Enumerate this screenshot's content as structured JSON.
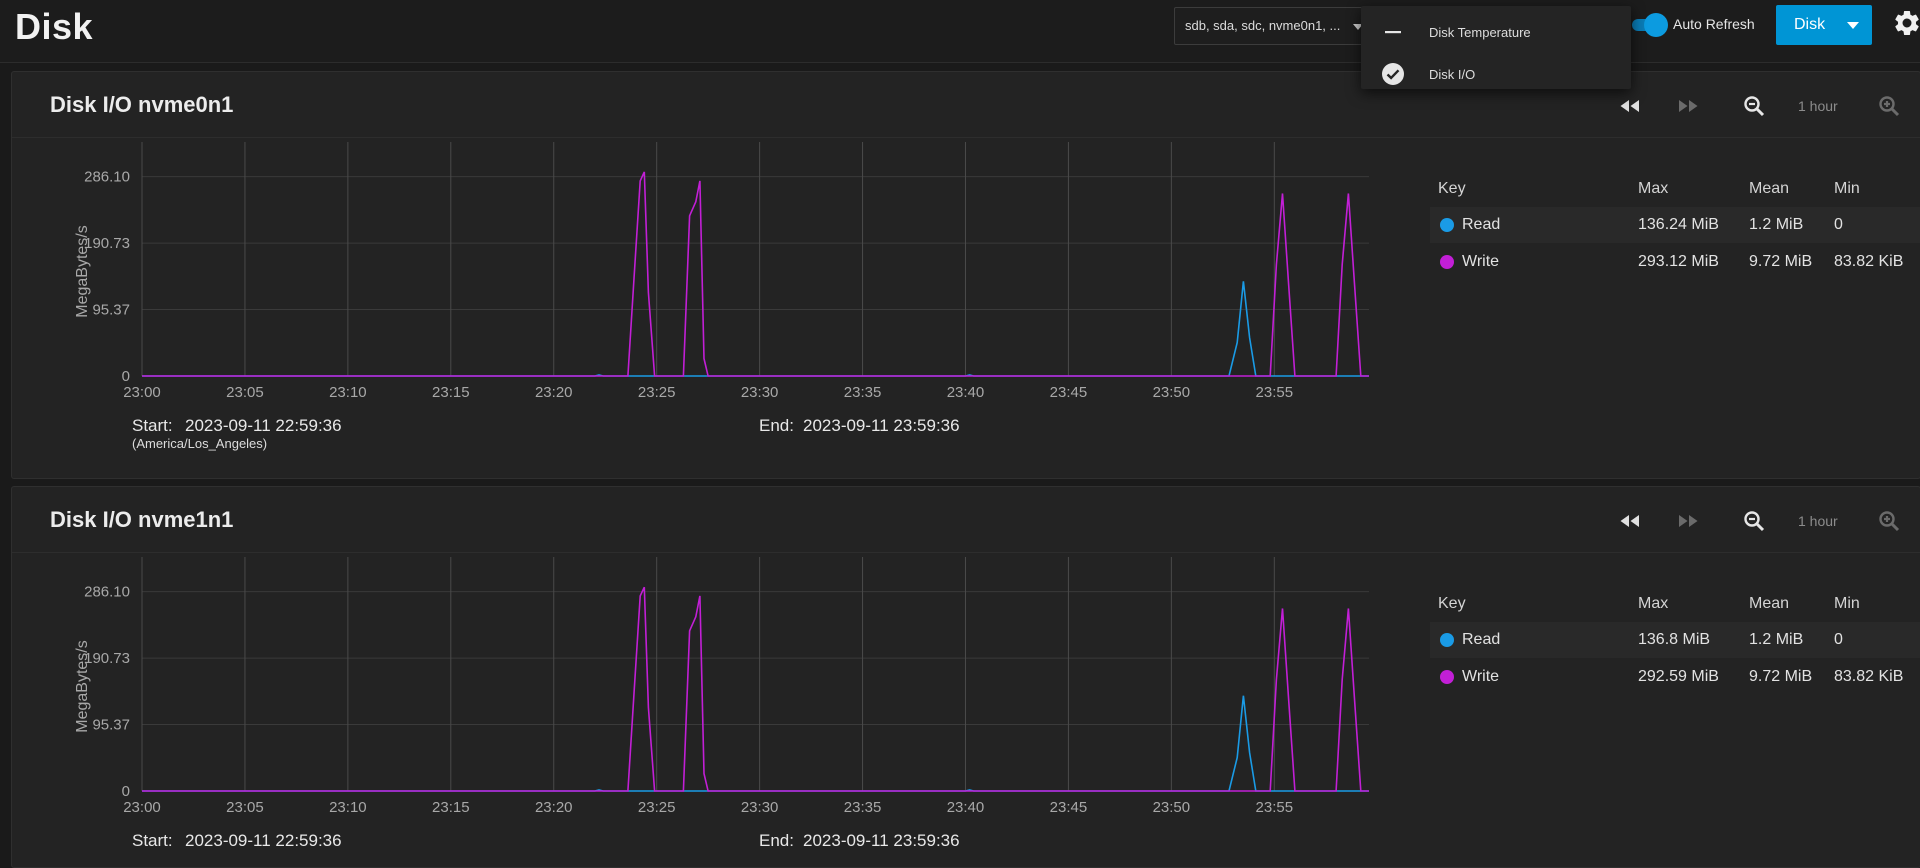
{
  "page": {
    "title": "Disk"
  },
  "toolbar": {
    "disk_select_value": "sdb, sda, sdc, nvme0n1, ...",
    "auto_refresh_label": "Auto Refresh",
    "disk_button_label": "Disk",
    "auto_refresh_on": true
  },
  "report_menu": {
    "items": [
      {
        "label": "Disk Temperature",
        "icon": "minus-icon",
        "checked": false
      },
      {
        "label": "Disk I/O",
        "icon": "check-circle-icon",
        "checked": true
      }
    ]
  },
  "colors": {
    "read": "#1a9be6",
    "write": "#c21fd6",
    "accent": "#0095d5"
  },
  "legend_headers": {
    "key": "Key",
    "max": "Max",
    "mean": "Mean",
    "min": "Min"
  },
  "charts": [
    {
      "title": "Disk I/O nvme0n1",
      "range_label": "1 hour",
      "start_label": "Start:",
      "start_value": "2023-09-11 22:59:36",
      "timezone": "(America/Los_Angeles)",
      "end_label": "End:",
      "end_value": "2023-09-11 23:59:36",
      "legend": [
        {
          "name": "Read",
          "max": "136.24 MiB",
          "mean": "1.2 MiB",
          "min": "0"
        },
        {
          "name": "Write",
          "max": "293.12 MiB",
          "mean": "9.72 MiB",
          "min": "83.82 KiB"
        }
      ]
    },
    {
      "title": "Disk I/O nvme1n1",
      "range_label": "1 hour",
      "start_label": "Start:",
      "start_value": "2023-09-11 22:59:36",
      "end_label": "End:",
      "end_value": "2023-09-11 23:59:36",
      "legend": [
        {
          "name": "Read",
          "max": "136.8 MiB",
          "mean": "1.2 MiB",
          "min": "0"
        },
        {
          "name": "Write",
          "max": "292.59 MiB",
          "mean": "9.72 MiB",
          "min": "83.82 KiB"
        }
      ]
    }
  ],
  "chart_data": [
    {
      "type": "line",
      "ylabel": "MegaBytes/s",
      "yticks": [
        0,
        95.37,
        190.73,
        286.1
      ],
      "ylim": [
        0,
        300
      ],
      "x_ticks": [
        "23:00",
        "23:05",
        "23:10",
        "23:15",
        "23:20",
        "23:25",
        "23:30",
        "23:35",
        "23:40",
        "23:45",
        "23:50",
        "23:55"
      ],
      "x_ticks_minutes": [
        0,
        5,
        10,
        15,
        20,
        25,
        30,
        35,
        40,
        45,
        50,
        55
      ],
      "xlim_minutes": [
        0,
        59.6
      ],
      "grid": true,
      "series": [
        {
          "name": "Read",
          "points": [
            [
              0,
              0
            ],
            [
              22.0,
              0
            ],
            [
              22.2,
              1.5
            ],
            [
              22.4,
              0
            ],
            [
              40.0,
              0
            ],
            [
              40.2,
              1.5
            ],
            [
              40.4,
              0
            ],
            [
              52.8,
              0
            ],
            [
              53.2,
              48
            ],
            [
              53.5,
              136
            ],
            [
              53.8,
              55
            ],
            [
              54.1,
              0
            ],
            [
              59.6,
              0
            ]
          ]
        },
        {
          "name": "Write",
          "points": [
            [
              0,
              0
            ],
            [
              23.6,
              0
            ],
            [
              23.9,
              140
            ],
            [
              24.2,
              280
            ],
            [
              24.4,
              293
            ],
            [
              24.6,
              120
            ],
            [
              24.9,
              0
            ],
            [
              26.3,
              0
            ],
            [
              26.6,
              230
            ],
            [
              26.9,
              250
            ],
            [
              27.1,
              280
            ],
            [
              27.3,
              25
            ],
            [
              27.5,
              0
            ],
            [
              54.8,
              0
            ],
            [
              55.1,
              160
            ],
            [
              55.4,
              262
            ],
            [
              55.7,
              130
            ],
            [
              56.0,
              0
            ],
            [
              58.0,
              0
            ],
            [
              58.3,
              160
            ],
            [
              58.6,
              262
            ],
            [
              58.9,
              130
            ],
            [
              59.2,
              0
            ],
            [
              59.6,
              0
            ]
          ]
        }
      ]
    },
    {
      "type": "line",
      "ylabel": "MegaBytes/s",
      "yticks": [
        0,
        95.37,
        190.73,
        286.1
      ],
      "ylim": [
        0,
        300
      ],
      "x_ticks": [
        "23:00",
        "23:05",
        "23:10",
        "23:15",
        "23:20",
        "23:25",
        "23:30",
        "23:35",
        "23:40",
        "23:45",
        "23:50",
        "23:55"
      ],
      "x_ticks_minutes": [
        0,
        5,
        10,
        15,
        20,
        25,
        30,
        35,
        40,
        45,
        50,
        55
      ],
      "xlim_minutes": [
        0,
        59.6
      ],
      "grid": true,
      "series": [
        {
          "name": "Read",
          "points": [
            [
              0,
              0
            ],
            [
              22.0,
              0
            ],
            [
              22.2,
              1.5
            ],
            [
              22.4,
              0
            ],
            [
              40.0,
              0
            ],
            [
              40.2,
              1.5
            ],
            [
              40.4,
              0
            ],
            [
              52.8,
              0
            ],
            [
              53.2,
              48
            ],
            [
              53.5,
              136.8
            ],
            [
              53.8,
              55
            ],
            [
              54.1,
              0
            ],
            [
              59.6,
              0
            ]
          ]
        },
        {
          "name": "Write",
          "points": [
            [
              0,
              0
            ],
            [
              23.6,
              0
            ],
            [
              23.9,
              140
            ],
            [
              24.2,
              280
            ],
            [
              24.4,
              292.59
            ],
            [
              24.6,
              120
            ],
            [
              24.9,
              0
            ],
            [
              26.3,
              0
            ],
            [
              26.6,
              230
            ],
            [
              26.9,
              250
            ],
            [
              27.1,
              280
            ],
            [
              27.3,
              25
            ],
            [
              27.5,
              0
            ],
            [
              54.8,
              0
            ],
            [
              55.1,
              160
            ],
            [
              55.4,
              262
            ],
            [
              55.7,
              130
            ],
            [
              56.0,
              0
            ],
            [
              58.0,
              0
            ],
            [
              58.3,
              160
            ],
            [
              58.6,
              262
            ],
            [
              58.9,
              130
            ],
            [
              59.2,
              0
            ],
            [
              59.6,
              0
            ]
          ]
        }
      ]
    }
  ]
}
